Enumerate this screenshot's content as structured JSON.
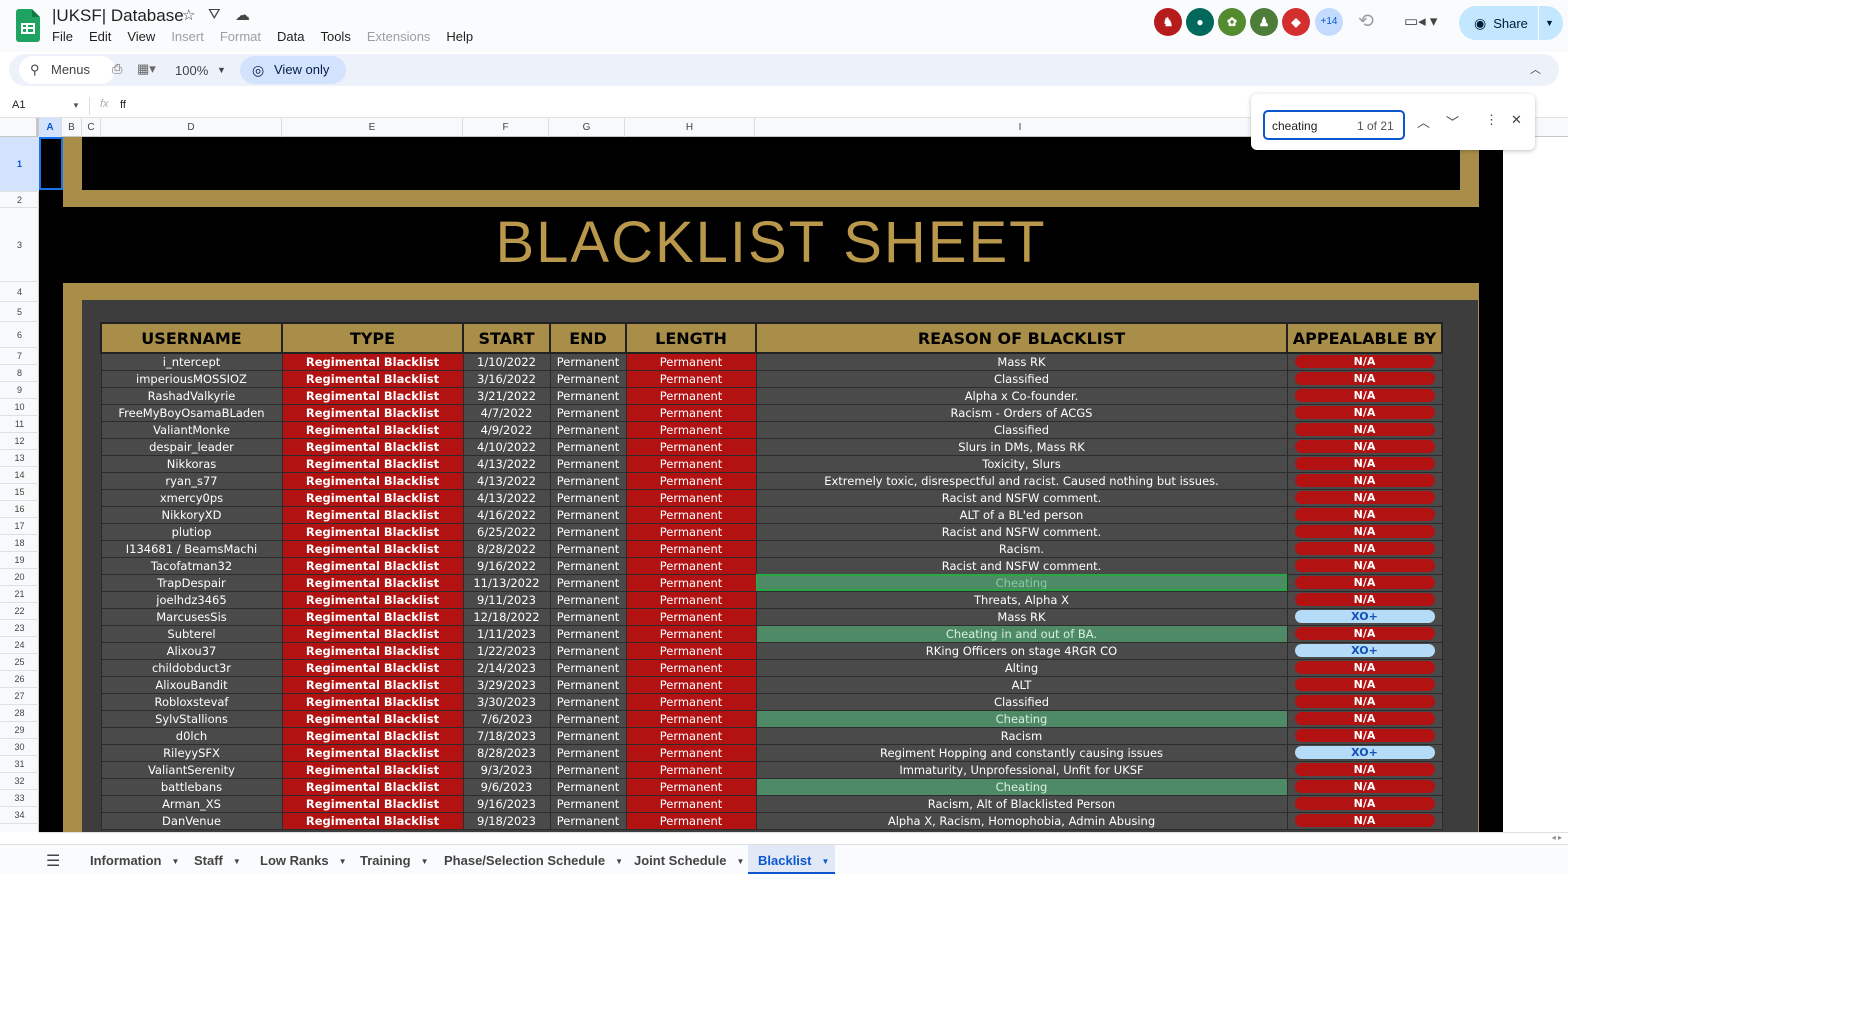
{
  "header": {
    "title": "|UKSF| Database",
    "menu": [
      {
        "label": "File",
        "disabled": false
      },
      {
        "label": "Edit",
        "disabled": false
      },
      {
        "label": "View",
        "disabled": false
      },
      {
        "label": "Insert",
        "disabled": true
      },
      {
        "label": "Format",
        "disabled": true
      },
      {
        "label": "Data",
        "disabled": false
      },
      {
        "label": "Tools",
        "disabled": false
      },
      {
        "label": "Extensions",
        "disabled": true
      },
      {
        "label": "Help",
        "disabled": false
      }
    ],
    "more_users": "+14",
    "share_label": "Share"
  },
  "toolbar": {
    "menus_label": "Menus",
    "zoom": "100%",
    "view_only_label": "View only"
  },
  "formula_bar": {
    "cell_ref": "A1",
    "value": "ff"
  },
  "columns": [
    {
      "name": "A",
      "selected": true
    },
    {
      "name": "B"
    },
    {
      "name": "C"
    },
    {
      "name": "D"
    },
    {
      "name": "E"
    },
    {
      "name": "F"
    },
    {
      "name": "G"
    },
    {
      "name": "H"
    },
    {
      "name": "I"
    },
    {
      "name": ""
    }
  ],
  "row_numbers": [
    "1",
    "2",
    "3",
    "4",
    "5",
    "6",
    "7",
    "8",
    "9",
    "10",
    "11",
    "12",
    "13",
    "14",
    "15",
    "16",
    "17",
    "18",
    "19",
    "20",
    "21",
    "22",
    "23",
    "24",
    "25",
    "26",
    "27",
    "28",
    "29",
    "30",
    "31",
    "32",
    "33",
    "34"
  ],
  "sheet": {
    "title": "BLACKLIST SHEET",
    "headers": [
      "USERNAME",
      "TYPE",
      "START",
      "END",
      "LENGTH",
      "REASON OF BLACKLIST",
      "APPEALABLE BY"
    ],
    "rows": [
      {
        "username": "i_ntercept",
        "type": "Regimental Blacklist",
        "start": "1/10/2022",
        "end": "Permanent",
        "length": "Permanent",
        "reason": "Mass RK",
        "appeal": "N/A"
      },
      {
        "username": "imperiousMOSSIOZ",
        "type": "Regimental Blacklist",
        "start": "3/16/2022",
        "end": "Permanent",
        "length": "Permanent",
        "reason": "Classified",
        "appeal": "N/A"
      },
      {
        "username": "RashadValkyrie",
        "type": "Regimental Blacklist",
        "start": "3/21/2022",
        "end": "Permanent",
        "length": "Permanent",
        "reason": "Alpha x Co-founder.",
        "appeal": "N/A"
      },
      {
        "username": "FreeMyBoyOsamaBLaden",
        "type": "Regimental Blacklist",
        "start": "4/7/2022",
        "end": "Permanent",
        "length": "Permanent",
        "reason": "Racism - Orders of ACGS",
        "appeal": "N/A"
      },
      {
        "username": "ValiantMonke",
        "type": "Regimental Blacklist",
        "start": "4/9/2022",
        "end": "Permanent",
        "length": "Permanent",
        "reason": "Classified",
        "appeal": "N/A"
      },
      {
        "username": "despair_leader",
        "type": "Regimental Blacklist",
        "start": "4/10/2022",
        "end": "Permanent",
        "length": "Permanent",
        "reason": "Slurs in DMs, Mass RK",
        "appeal": "N/A"
      },
      {
        "username": "Nikkoras",
        "type": "Regimental Blacklist",
        "start": "4/13/2022",
        "end": "Permanent",
        "length": "Permanent",
        "reason": "Toxicity, Slurs",
        "appeal": "N/A"
      },
      {
        "username": "ryan_s77",
        "type": "Regimental Blacklist",
        "start": "4/13/2022",
        "end": "Permanent",
        "length": "Permanent",
        "reason": "Extremely toxic, disrespectful and racist. Caused nothing but issues.",
        "appeal": "N/A"
      },
      {
        "username": "xmercy0ps",
        "type": "Regimental Blacklist",
        "start": "4/13/2022",
        "end": "Permanent",
        "length": "Permanent",
        "reason": "Racist and NSFW comment.",
        "appeal": "N/A"
      },
      {
        "username": "NikkoryXD",
        "type": "Regimental Blacklist",
        "start": "4/16/2022",
        "end": "Permanent",
        "length": "Permanent",
        "reason": "ALT of a BL'ed person",
        "appeal": "N/A"
      },
      {
        "username": "plutiop",
        "type": "Regimental Blacklist",
        "start": "6/25/2022",
        "end": "Permanent",
        "length": "Permanent",
        "reason": "Racist and NSFW comment.",
        "appeal": "N/A"
      },
      {
        "username": "I134681 / BeamsMachi",
        "type": "Regimental Blacklist",
        "start": "8/28/2022",
        "end": "Permanent",
        "length": "Permanent",
        "reason": "Racism.",
        "appeal": "N/A"
      },
      {
        "username": "Tacofatman32",
        "type": "Regimental Blacklist",
        "start": "9/16/2022",
        "end": "Permanent",
        "length": "Permanent",
        "reason": "Racist and NSFW comment.",
        "appeal": "N/A"
      },
      {
        "username": "TrapDespair",
        "type": "Regimental Blacklist",
        "start": "11/13/2022",
        "end": "Permanent",
        "length": "Permanent",
        "reason": "Cheating",
        "appeal": "N/A",
        "highlight": "found"
      },
      {
        "username": "joelhdz3465",
        "type": "Regimental Blacklist",
        "start": "9/11/2023",
        "end": "Permanent",
        "length": "Permanent",
        "reason": "Threats, Alpha X",
        "appeal": "N/A"
      },
      {
        "username": "MarcusesSis",
        "type": "Regimental Blacklist",
        "start": "12/18/2022",
        "end": "Permanent",
        "length": "Permanent",
        "reason": "Mass RK",
        "appeal": "XO+"
      },
      {
        "username": "Subterel",
        "type": "Regimental Blacklist",
        "start": "1/11/2023",
        "end": "Permanent",
        "length": "Permanent",
        "reason": "Cheating in and out of BA.",
        "appeal": "N/A",
        "highlight": "cheat"
      },
      {
        "username": "Alixou37",
        "type": "Regimental Blacklist",
        "start": "1/22/2023",
        "end": "Permanent",
        "length": "Permanent",
        "reason": "RKing Officers on stage 4RGR CO",
        "appeal": "XO+"
      },
      {
        "username": "childobduct3r",
        "type": "Regimental Blacklist",
        "start": "2/14/2023",
        "end": "Permanent",
        "length": "Permanent",
        "reason": "Alting",
        "appeal": "N/A"
      },
      {
        "username": "AlixouBandit",
        "type": "Regimental Blacklist",
        "start": "3/29/2023",
        "end": "Permanent",
        "length": "Permanent",
        "reason": "ALT",
        "appeal": "N/A"
      },
      {
        "username": "Robloxstevaf",
        "type": "Regimental Blacklist",
        "start": "3/30/2023",
        "end": "Permanent",
        "length": "Permanent",
        "reason": "Classified",
        "appeal": "N/A"
      },
      {
        "username": "SylvStallions",
        "type": "Regimental Blacklist",
        "start": "7/6/2023",
        "end": "Permanent",
        "length": "Permanent",
        "reason": "Cheating",
        "appeal": "N/A",
        "highlight": "cheat"
      },
      {
        "username": "d0lch",
        "type": "Regimental Blacklist",
        "start": "7/18/2023",
        "end": "Permanent",
        "length": "Permanent",
        "reason": "Racism",
        "appeal": "N/A"
      },
      {
        "username": "RileyySFX",
        "type": "Regimental Blacklist",
        "start": "8/28/2023",
        "end": "Permanent",
        "length": "Permanent",
        "reason": "Regiment Hopping and constantly causing issues",
        "appeal": "XO+"
      },
      {
        "username": "ValiantSerenity",
        "type": "Regimental Blacklist",
        "start": "9/3/2023",
        "end": "Permanent",
        "length": "Permanent",
        "reason": "Immaturity, Unprofessional, Unfit for UKSF",
        "appeal": "N/A"
      },
      {
        "username": "battlebans",
        "type": "Regimental Blacklist",
        "start": "9/6/2023",
        "end": "Permanent",
        "length": "Permanent",
        "reason": "Cheating",
        "appeal": "N/A",
        "highlight": "cheat"
      },
      {
        "username": "Arman_XS",
        "type": "Regimental Blacklist",
        "start": "9/16/2023",
        "end": "Permanent",
        "length": "Permanent",
        "reason": "Racism, Alt of Blacklisted Person",
        "appeal": "N/A"
      },
      {
        "username": "DanVenue",
        "type": "Regimental Blacklist",
        "start": "9/18/2023",
        "end": "Permanent",
        "length": "Permanent",
        "reason": "Alpha X, Racism, Homophobia, Admin Abusing",
        "appeal": "N/A"
      }
    ]
  },
  "find": {
    "query": "cheating",
    "count": "1 of 21"
  },
  "tabs": [
    {
      "label": "Information"
    },
    {
      "label": "Staff"
    },
    {
      "label": "Low Ranks"
    },
    {
      "label": "Training"
    },
    {
      "label": "Phase/Selection Schedule"
    },
    {
      "label": "Joint Schedule"
    },
    {
      "label": "Blacklist",
      "active": true
    }
  ],
  "colors": {
    "gold": "#a88e48",
    "title_gold": "#b9984c",
    "red": "#b31212",
    "cheat_green": "#4e8a65",
    "xo_blue": "#b4dcf8"
  },
  "icons": [
    "sheets-logo",
    "star-icon",
    "move-icon",
    "cloud-icon",
    "history-icon",
    "video-call-icon",
    "globe-icon",
    "search-icon",
    "print-icon",
    "format-icon",
    "eye-icon",
    "chevron-up-icon",
    "chevron-down-icon",
    "more-vert-icon",
    "close-icon",
    "menu-icon"
  ]
}
